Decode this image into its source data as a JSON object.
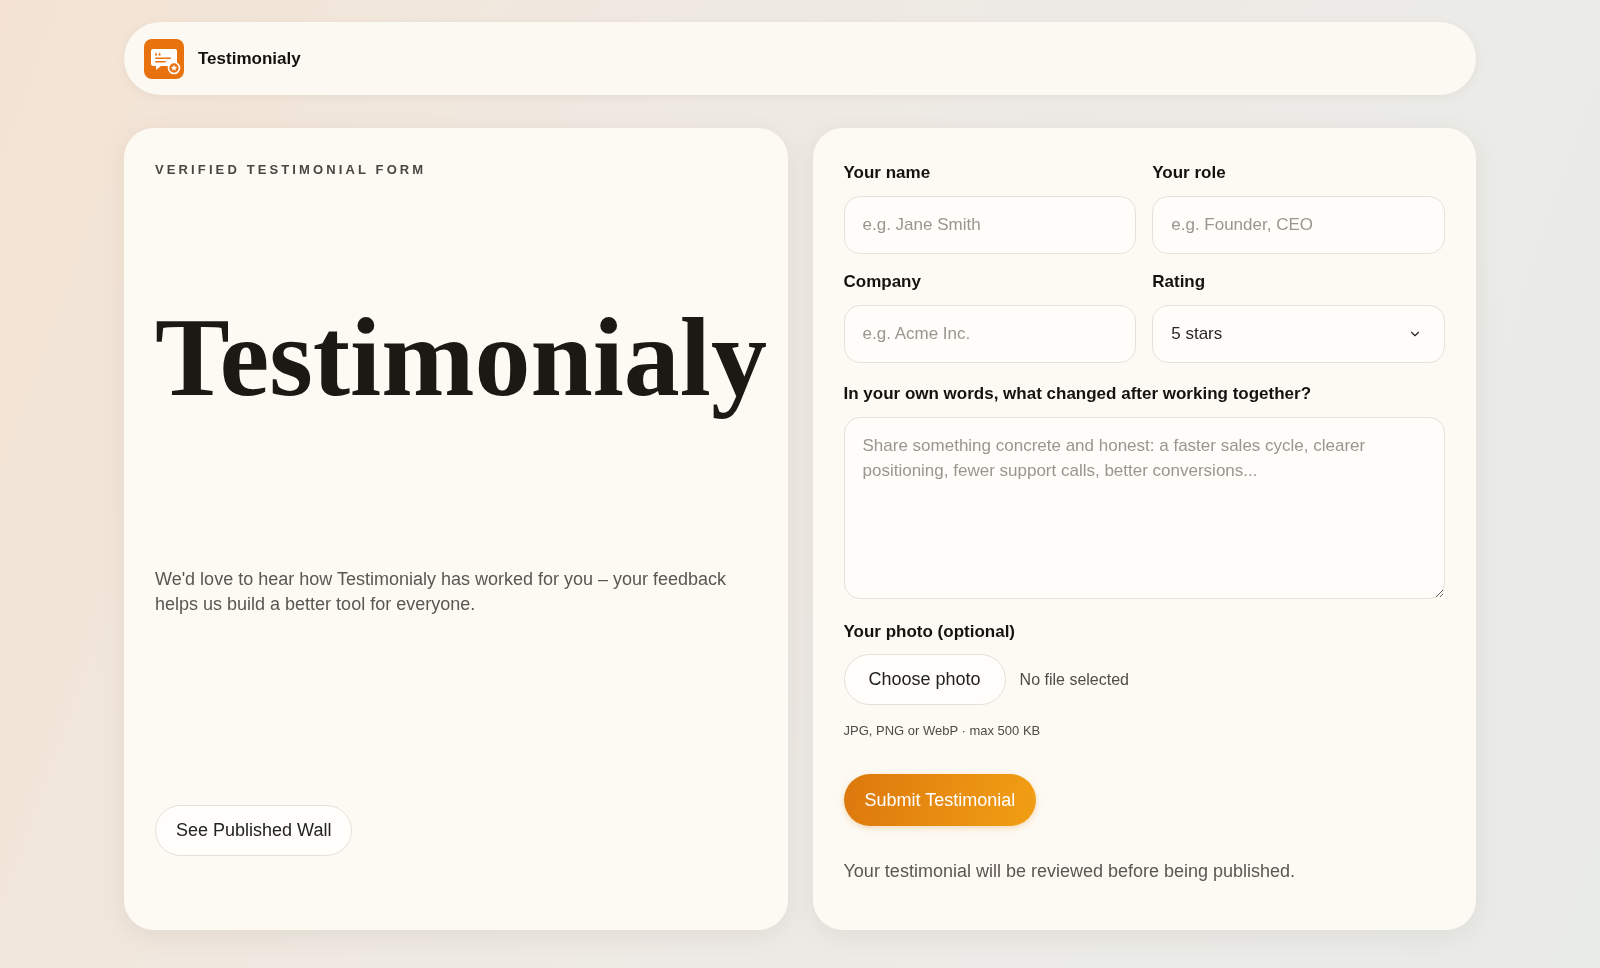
{
  "header": {
    "brand": "Testimonialy"
  },
  "intro": {
    "eyebrow": "VERIFIED TESTIMONIAL FORM",
    "title": "Testimonialy",
    "description": "We'd love to hear how Testimonialy has worked for you – your feedback helps us build a better tool for everyone.",
    "wall_button": "See Published Wall"
  },
  "form": {
    "fields": [
      {
        "kind": "text",
        "label": "Your name",
        "placeholder": "e.g. Jane Smith"
      },
      {
        "kind": "text",
        "label": "Your role",
        "placeholder": "e.g. Founder, CEO"
      },
      {
        "kind": "text",
        "label": "Company",
        "placeholder": "e.g. Acme Inc."
      },
      {
        "kind": "select",
        "label": "Rating",
        "value": "5 stars"
      }
    ],
    "message": {
      "label": "In your own words, what changed after working together?",
      "placeholder": "Share something concrete and honest: a faster sales cycle, clearer positioning, fewer support calls, better conversions..."
    },
    "photo": {
      "label": "Your photo (optional)",
      "button": "Choose photo",
      "status": "No file selected",
      "hint": "JPG, PNG or WebP · max 500 KB"
    },
    "submit": "Submit Testimonial",
    "note": "Your testimonial will be reviewed before being published."
  }
}
